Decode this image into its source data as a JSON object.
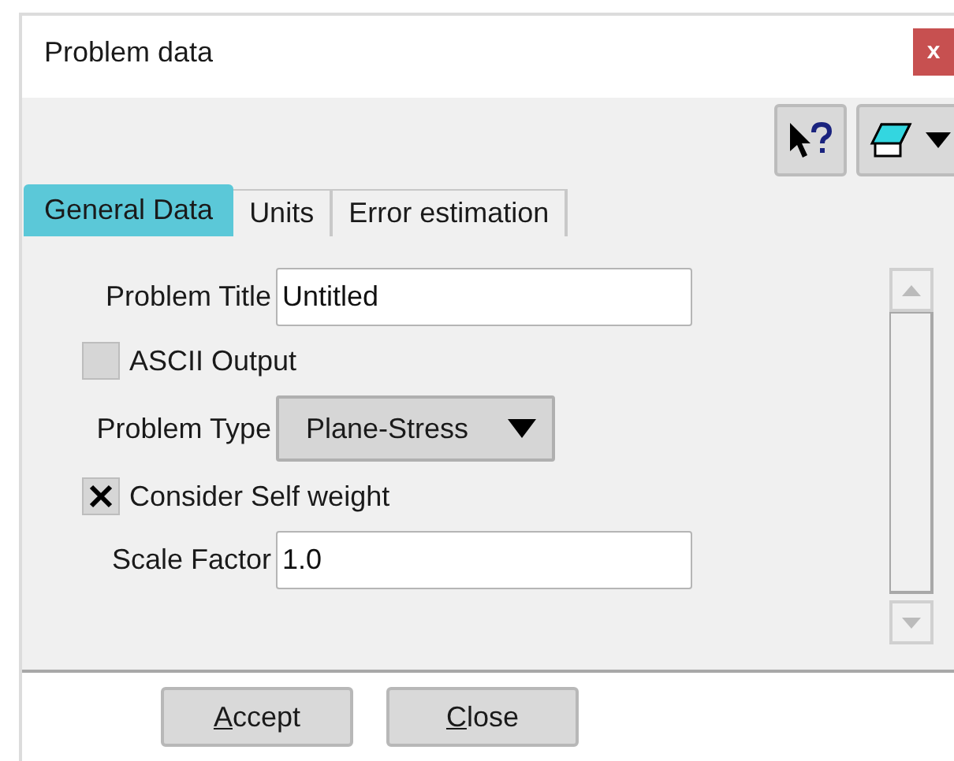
{
  "window": {
    "title": "Problem data",
    "close": "x"
  },
  "tabs": [
    {
      "label": "General Data",
      "selected": true
    },
    {
      "label": "Units",
      "selected": false
    },
    {
      "label": "Error estimation",
      "selected": false
    }
  ],
  "fields": [
    {
      "kind": "text",
      "label": "Problem Title",
      "value": "Untitled"
    },
    {
      "kind": "checkbox",
      "label": "ASCII Output",
      "checked": false
    },
    {
      "kind": "select",
      "label": "Problem Type",
      "value": "Plane-Stress"
    },
    {
      "kind": "checkbox",
      "label": "Consider Self weight",
      "checked": true
    },
    {
      "kind": "text",
      "label": "Scale Factor",
      "value": "1.0"
    }
  ],
  "buttons": [
    "Accept",
    "Close"
  ]
}
